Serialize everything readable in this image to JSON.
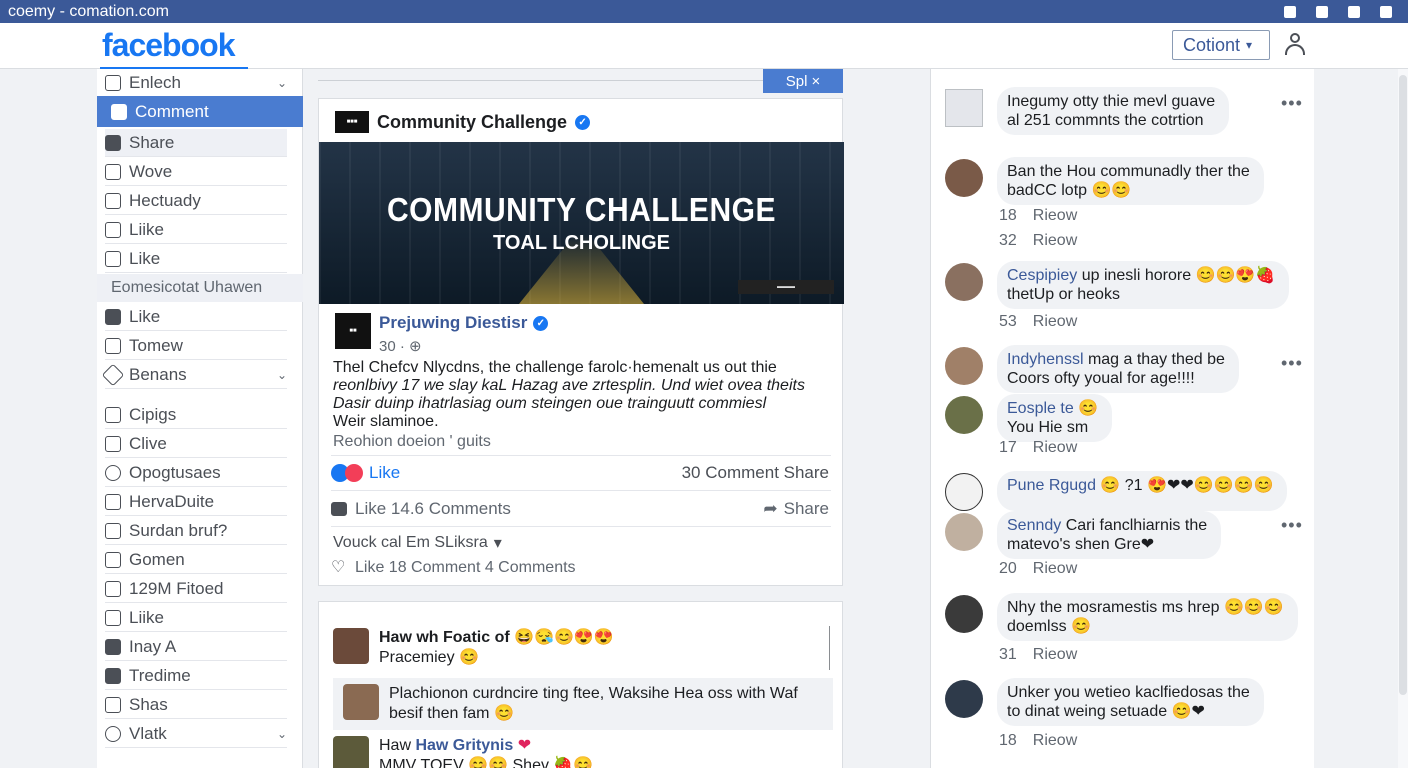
{
  "browser": {
    "url": "coemy - comation.com"
  },
  "header": {
    "logo": "facebook",
    "select_label": "Cotiont",
    "select_caret": "▾"
  },
  "sidebar": {
    "items": [
      {
        "label": "Enlech",
        "icon": "square-icon",
        "chevron": "⌄"
      },
      {
        "label": "Comment",
        "icon": "comment-icon"
      },
      {
        "label": "Share",
        "icon": "share-icon"
      },
      {
        "label": "Wove",
        "icon": "mail-icon"
      },
      {
        "label": "Hectuady",
        "icon": "edit-icon"
      },
      {
        "label": "Liike",
        "icon": "photo-icon"
      },
      {
        "label": "Like",
        "icon": "bookmark-icon"
      }
    ],
    "section": "Eomesicotat Uhawen",
    "items2": [
      {
        "label": "Like",
        "icon": "puzzle-icon"
      },
      {
        "label": "Tomew",
        "icon": "bookmark-icon"
      },
      {
        "label": "Benans",
        "icon": "tag-icon",
        "chevron": "⌄"
      }
    ],
    "items3": [
      {
        "label": "Cipigs",
        "icon": "thumb-icon"
      },
      {
        "label": "Clive",
        "icon": "grid-icon"
      },
      {
        "label": "Opogtusaes",
        "icon": "circle-icon"
      },
      {
        "label": "HervaDuite",
        "icon": "camera-icon"
      },
      {
        "label": "Surdan bruf?",
        "icon": "chat-icon"
      },
      {
        "label": "Gomen",
        "icon": "edit-icon"
      },
      {
        "label": "129M Fitoed",
        "icon": "tag-icon"
      },
      {
        "label": "Liike",
        "icon": "calendar-icon"
      },
      {
        "label": "Inay A",
        "icon": "puzzle-icon"
      },
      {
        "label": "Tredime",
        "icon": "video-icon"
      },
      {
        "label": "Shas",
        "icon": "doc-icon"
      },
      {
        "label": "Vlatk",
        "icon": "plus-icon",
        "chevron": "⌄"
      }
    ]
  },
  "feed": {
    "split_label": "Spl",
    "split_close": "×",
    "post": {
      "page_name": "Community Challenge",
      "banner_title": "COMMUNITY CHALLENGE",
      "banner_subtitle": "TOAL LCHOLINGE",
      "author_name": "Prejuwing Diestisr",
      "author_meta": "30 · ⊕",
      "body_line1": "Thel Chefcv Nlycdns, the challenge farolc·hemenalt us out thie",
      "body_line2": "reonlbivy 17 we slay kaL Hazag ave zrtesplin. Und wiet ovea theits",
      "body_line3": "Dasir duinp ihatrlasiag oum steingen oue trainguutt commiesl",
      "body_line4": "Weir slaminoe.",
      "body_reply": "Reohion doeion ' guits",
      "like_label": "Like",
      "right_stats": "30 Comment Share",
      "action_like": "Like 14.6 Comments",
      "action_share": "Share",
      "sort_label": "Vouck cal Em SLiksra",
      "sort_caret": "▾",
      "footer": "Like 18 Comment 4 Comments"
    },
    "post2": {
      "c1_line1": "Haw wh Foatic of 😆😪😊😍😍",
      "c1_line2": "Pracemiey 😊",
      "c2_line1": "Plachionon curdncire ting ftee, Waksihe Hea oss with Waf",
      "c2_line2": "besif then fam 😊",
      "c3_name": "Haw Gritynis",
      "c3_heart": "❤",
      "c3_line2": "MMV TOEV 😊😊 Shev 🍓😊"
    }
  },
  "rightpanel": {
    "c1": {
      "text1": "Inegumy otty thie mevl guave",
      "text2": "al 251 commnts the cotrtion",
      "dots": "•••"
    },
    "c2": {
      "text1": "Ban the Hou communadly ther the",
      "text2": "badCC lotp 😊😊",
      "meta1_num": "18",
      "meta1_lbl": "Rieow",
      "meta2_num": "32",
      "meta2_lbl": "Rieow"
    },
    "c3": {
      "name": "Cespipiey",
      "text1": " up inesli horore 😊😊😍🍓",
      "text2": "thetUp or heoks",
      "meta_num": "53",
      "meta_lbl": "Rieow"
    },
    "c4": {
      "name": "Indyhenssl",
      "text1": " mag a thay thed be",
      "text2": "Coors ofty youal for age!!!!",
      "dots": "•••"
    },
    "c5": {
      "name": "Eosple te",
      "emoji": "😊",
      "text2": "You Hie sm",
      "meta_num": "17",
      "meta_lbl": "Rieow"
    },
    "c6": {
      "name": "Pune Rgugd",
      "text1": " 😊 ?1 😍❤❤😊😊😊😊"
    },
    "c7": {
      "name": "Senndy",
      "text1": " Cari fanclhiarnis the",
      "text2": "matevo's shen Gre❤",
      "dots": "•••",
      "meta_num": "20",
      "meta_lbl": "Rieow"
    },
    "c8": {
      "text1": "Nhy the mosramestis ms hrep 😊😊😊",
      "text2": "doemlss 😊",
      "meta_num": "31",
      "meta_lbl": "Rieow"
    },
    "c9": {
      "text1": "Unker you wetieo kaclfiedosas the",
      "text2": "to dinat weing setuade 😊❤",
      "meta_num": "18",
      "meta_lbl": "Rieow"
    }
  },
  "colors": {
    "brand": "#1877f2",
    "topbar": "#3b5998",
    "active": "#4a7cd0"
  }
}
